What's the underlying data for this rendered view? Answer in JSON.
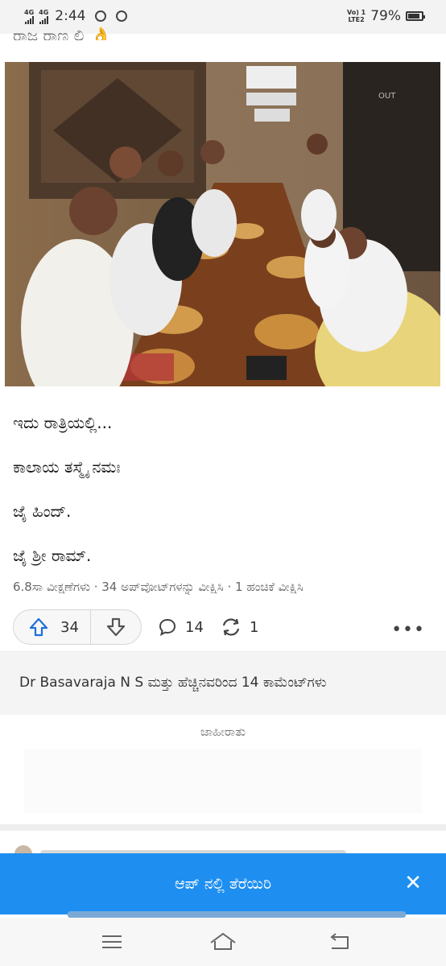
{
  "status_bar": {
    "network1": "4G",
    "network2": "4G",
    "time": "2:44",
    "carrier": "Vo) 1\nLTE2",
    "battery": "79%"
  },
  "post": {
    "cut_title": "ರಾಜ ರಾಣ ಲ್ಲಿ 👌",
    "lines": [
      "ಇದು ರಾತ್ರಿಯಲ್ಲಿ...",
      "ಕಾಲಾಯ ತಸ್ಮೈ ನಮಃ",
      "ಜೈ ಹಿಂದ್.",
      "ಜೈ ಶ್ರೀ ರಾಮ್."
    ],
    "meta": "6.8ಸಾ ವೀಕ್ಷಣೆಗಳು · 34 ಅಪ್‌ವೋಟ್‌ಗಳನ್ನು ವೀಕ್ಷಿಸಿ · 1 ಹಂಚಿಕೆ ವೀಕ್ಷಿಸಿ",
    "upvotes": "34",
    "comments": "14",
    "shares": "1",
    "more": "•••",
    "photo_sign": "OUT"
  },
  "comments_summary": "Dr Basavaraja N S ಮತ್ತು ಹೆಚ್ಚಿನವರಿಂದ 14 ಕಾಮೆಂಟ್‌ಗಳು",
  "ad_label": "ಜಾಹೀರಾತು",
  "banner": {
    "text": "ಆಪ್ ನಲ್ಲಿ ತೆರೆಯಿರಿ",
    "close": "✕"
  },
  "colors": {
    "accent": "#1e8ff1",
    "upvote": "#1e6fd9"
  }
}
